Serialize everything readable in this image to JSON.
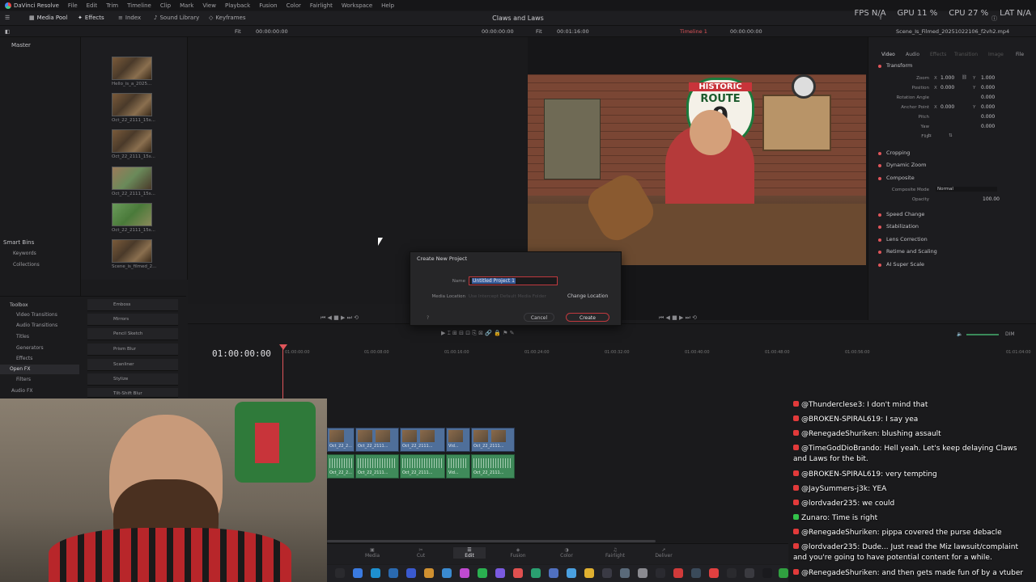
{
  "app": {
    "name": "DaVinci Resolve",
    "project_title": "Claws and Laws",
    "menu": [
      "File",
      "Edit",
      "Trim",
      "Timeline",
      "Clip",
      "Mark",
      "View",
      "Playback",
      "Fusion",
      "Color",
      "Fairlight",
      "Workspace",
      "Help"
    ]
  },
  "stats": {
    "fps": "FPS N/A",
    "gpu": "GPU 11 %",
    "cpu": "CPU 27 %",
    "lat": "LAT N/A"
  },
  "toolbar": {
    "media_pool": "Media Pool",
    "effects": "Effects",
    "index": "Index",
    "sound_library": "Sound Library",
    "keyframes": "Keyframes",
    "fit": "Fit",
    "source_tc": "00:00:00:00",
    "source_tc2": "00:00:00:00",
    "fit2": "Fit",
    "duration_tc": "00:01:16:00",
    "timeline_name": "Timeline 1",
    "program_tc": "00:00:00:00",
    "clip_name": "Scene_Is_Filmed_20251022106_f2vh2.mp4"
  },
  "bins": {
    "master": "Master",
    "smart_bins": "Smart Bins",
    "keywords": "Keywords",
    "collections": "Collections"
  },
  "thumbnails": [
    "Hello_is_a_2025...",
    "Oct_22_2111_15s...",
    "Oct_22_2111_15s...",
    "Oct_22_2111_15s...",
    "Oct_22_2111_15s...",
    "Scene_is_filmed_2..."
  ],
  "toolbox": {
    "toolbox": "Toolbox",
    "video_transitions": "Video Transitions",
    "audio_transitions": "Audio Transitions",
    "titles": "Titles",
    "generators": "Generators",
    "effects": "Effects",
    "open_fx": "Open FX",
    "filters": "Filters",
    "audio_fx": "Audio FX",
    "items": [
      "Emboss",
      "Mirrors",
      "Pencil Sketch",
      "Prism Blur",
      "Scanliner",
      "Stylize",
      "Tilt-Shift Blur"
    ]
  },
  "video_tabs": {
    "video": "Video",
    "audio": "Audio",
    "effects": "Effects",
    "transition": "Transition",
    "image": "Image",
    "file": "File"
  },
  "inspector": {
    "transform": "Transform",
    "zoom": "Zoom",
    "position": "Position",
    "rotation": "Rotation Angle",
    "anchor": "Anchor Point",
    "pitch": "Pitch",
    "yaw": "Yaw",
    "flip": "Flip",
    "zoom_x": "1.000",
    "zoom_y": "1.000",
    "pos_x": "0.000",
    "pos_y": "0.000",
    "rot": "0.000",
    "anchor_x": "0.000",
    "anchor_y": "0.000",
    "pitch_v": "0.000",
    "yaw_v": "0.000",
    "x": "X",
    "y": "Y",
    "cropping": "Cropping",
    "dynamic_zoom": "Dynamic Zoom",
    "composite": "Composite",
    "composite_mode": "Composite Mode",
    "composite_mode_value": "Normal",
    "opacity": "Opacity",
    "opacity_value": "100.00",
    "speed_change": "Speed Change",
    "stabilization": "Stabilization",
    "lens_correction": "Lens Correction",
    "retime": "Retime and Scaling",
    "super_scale": "AI Super Scale"
  },
  "dialog": {
    "title": "Create New Project",
    "name_label": "Name",
    "name_value": "Untitled Project 1",
    "location_label": "Media Location",
    "location_value": "Use Intercept Default Media Folder",
    "change_location": "Change Location",
    "cancel": "Cancel",
    "create": "Create",
    "help": "?"
  },
  "timeline": {
    "timecode": "01:00:00:00",
    "ticks": [
      "01:00:00:00",
      "01:00:08:00",
      "01:00:16:00",
      "01:00:24:00",
      "01:00:32:00",
      "01:00:40:00",
      "01:00:48:00",
      "01:00:56:00",
      "01:01:04:00"
    ],
    "clip_labels": [
      "Oct_22_2...",
      "Oct_22_2111...",
      "Oct_22_2111...",
      "Vid...",
      "Oct_22_2111..."
    ],
    "dim": "DIM"
  },
  "pages": [
    "Media",
    "Cut",
    "Edit",
    "Fusion",
    "Color",
    "Fairlight",
    "Deliver"
  ],
  "chat": [
    {
      "user": "@Thunderclese3",
      "text": "I don't mind that",
      "badge": "red"
    },
    {
      "user": "@BROKEN-SPIRAL619",
      "text": "I say yea",
      "badge": "red"
    },
    {
      "user": "@RenegadeShuriken",
      "text": "blushing assault",
      "badge": "red"
    },
    {
      "user": "@TimeGodDioBrando",
      "text": "Hell yeah. Let's keep delaying Claws and Laws for the bit.",
      "badge": "red"
    },
    {
      "user": "@BROKEN-SPIRAL619",
      "text": "very tempting",
      "badge": "red"
    },
    {
      "user": "@JaySummers-j3k",
      "text": "YEA",
      "badge": "red"
    },
    {
      "user": "@lordvader235",
      "text": "we could",
      "badge": "red"
    },
    {
      "user": "Zunaro",
      "text": "Time is right",
      "badge": "green"
    },
    {
      "user": "@RenegadeShuriken",
      "text": "pippa covered the purse debacle",
      "badge": "red"
    },
    {
      "user": "@lordvader235",
      "text": "Dude... Just read the Miz lawsuit/complaint and you're going to have potential content for a while.",
      "badge": "red"
    },
    {
      "user": "@RenegadeShuriken",
      "text": "and then gets made fun of by a vtuber",
      "badge": "red"
    }
  ],
  "colors": {
    "accent_red": "#e0555a",
    "video_clip": "#4f6f9a",
    "audio_clip": "#3f8a5a",
    "panel": "#1c1c1f"
  },
  "frame_sign": {
    "top": "HISTORIC",
    "mid": "ROUTE",
    "num": "9"
  }
}
